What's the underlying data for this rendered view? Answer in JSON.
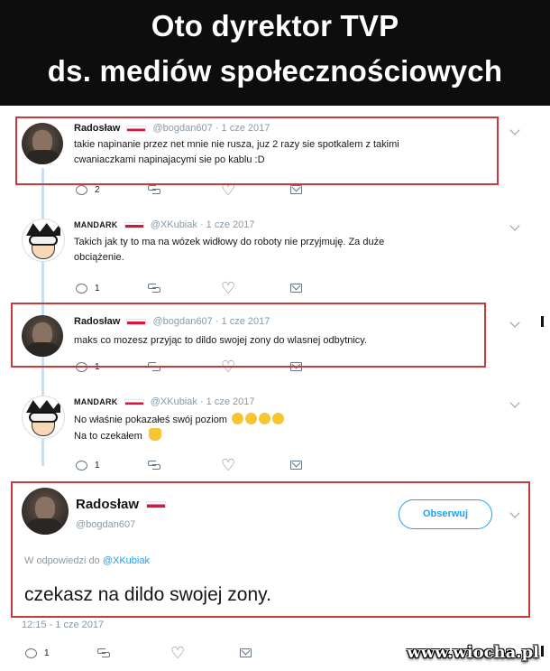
{
  "header": {
    "line1": "Oto dyrektor TVP",
    "line2": "ds. mediów społecznościowych"
  },
  "tweets": [
    {
      "name": "Radosław",
      "handle": "@bogdan607",
      "date": "1 cze 2017",
      "text_line1": "takie napinanie przez net mnie nie rusza, juz 2 razy sie spotkalem z takimi",
      "text_line2": "cwaniaczkami napinajacymi sie po kablu :D",
      "reply_count": "2",
      "highlighted": true
    },
    {
      "name": "MANDARK",
      "handle": "@XKubiak",
      "date": "1 cze 2017",
      "text_line1": "Takich jak ty to ma na wózek widłowy do roboty nie przyjmuję. Za duże",
      "text_line2": "obciążenie.",
      "reply_count": "1",
      "highlighted": false
    },
    {
      "name": "Radosław",
      "handle": "@bogdan607",
      "date": "1 cze 2017",
      "text_line1": "maks co mozesz przyjąc to dildo swojej zony do wlasnej odbytnicy.",
      "reply_count": "1",
      "highlighted": true
    },
    {
      "name": "MANDARK",
      "handle": "@XKubiak",
      "date": "1 cze 2017",
      "text_line1": "No właśnie pokazałeś swój poziom",
      "text_line2": "Na to czekałem",
      "reply_count": "1",
      "highlighted": false
    }
  ],
  "main_tweet": {
    "name": "Radosław",
    "handle": "@bogdan607",
    "follow_label": "Obserwuj",
    "reply_prefix": "W odpowiedzi do",
    "reply_to": "@XKubiak",
    "text": "czekasz na dildo swojej zony.",
    "timestamp": "12:15 - 1 cze 2017",
    "reply_count": "1"
  },
  "watermark": "www.wiocha.pl",
  "colors": {
    "highlight": "#c93a3a",
    "twitter_blue": "#1da1f2",
    "muted": "#8899a6"
  },
  "icons": [
    "reply-icon",
    "retweet-icon",
    "like-icon",
    "direct-message-icon",
    "chevron-down-icon",
    "poland-flag-icon"
  ]
}
